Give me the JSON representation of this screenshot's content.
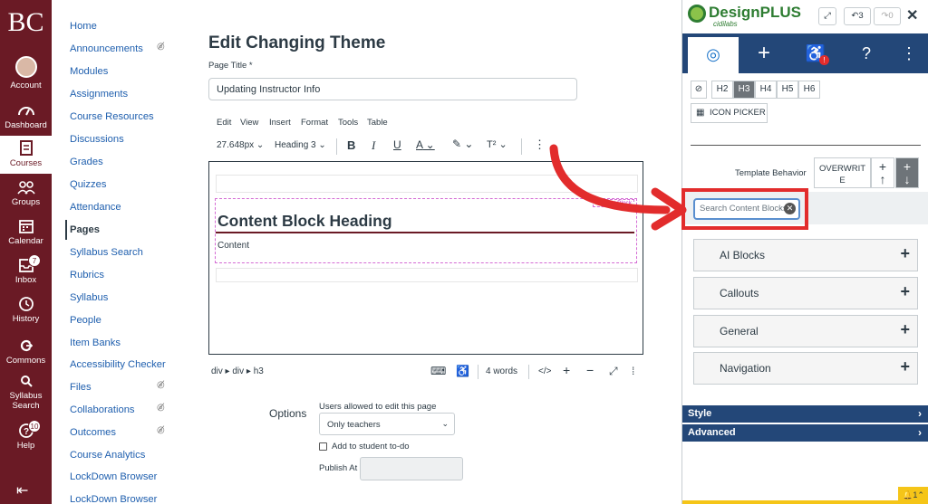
{
  "global_nav": {
    "logo": "BC",
    "items": [
      {
        "label": "Account",
        "icon": "avatar"
      },
      {
        "label": "Dashboard",
        "icon": "dashboard-icon"
      },
      {
        "label": "Courses",
        "icon": "courses-icon"
      },
      {
        "label": "Groups",
        "icon": "groups-icon"
      },
      {
        "label": "Calendar",
        "icon": "calendar-icon"
      },
      {
        "label": "Inbox",
        "icon": "inbox-icon",
        "badge": "7"
      },
      {
        "label": "History",
        "icon": "history-icon"
      },
      {
        "label": "Commons",
        "icon": "commons-icon"
      },
      {
        "label": "Syllabus",
        "label2": "Search",
        "icon": "search-icon"
      },
      {
        "label": "Help",
        "icon": "help-icon",
        "badge": "10"
      }
    ],
    "colors": {
      "background": "#6a1a25",
      "active": "#ffffff"
    }
  },
  "course_nav": {
    "links": [
      "Home",
      "Announcements",
      "Modules",
      "Assignments",
      "Course Resources",
      "Discussions",
      "Grades",
      "Quizzes",
      "Attendance",
      "Pages",
      "Syllabus Search",
      "Rubrics",
      "Syllabus",
      "People",
      "Item Banks",
      "Accessibility Checker",
      "Files",
      "Collaborations",
      "Outcomes",
      "Course Analytics",
      "LockDown Browser",
      "LockDown Browser"
    ],
    "active": "Pages"
  },
  "editor": {
    "page_heading": "Edit Changing Theme",
    "page_title_label": "Page Title",
    "required_mark": "*",
    "page_title_value": "Updating Instructor Info",
    "menu": [
      "Edit",
      "View",
      "Insert",
      "Format",
      "Tools",
      "Table"
    ],
    "toolbar": {
      "font_size": "27.648px",
      "block_format": "Heading 3",
      "bold": "B",
      "italic": "I",
      "underline": "U",
      "text_color": "A",
      "superscript": "T²",
      "more": "⋮"
    },
    "block_tag": "Content Block",
    "content_heading": "Content Block Heading",
    "content_text": "Content",
    "path": "div ▸ div ▸ h3",
    "word_count": "4 words",
    "code_view": "</>"
  },
  "options": {
    "label": "Options",
    "edit_label": "Users allowed to edit this page",
    "edit_value": "Only teachers",
    "todo_label": "Add to student to-do",
    "publish_at_label": "Publish At"
  },
  "designplus": {
    "brand": "DesignPLUS",
    "brand_sub": "cidilabs",
    "undo_count": "3",
    "redo_count": "0",
    "tabs": [
      "target-icon",
      "plus-icon",
      "accessibility-icon",
      "help-icon",
      "more-icon"
    ],
    "heading_buttons": [
      "H2",
      "H3",
      "H4",
      "H5",
      "H6"
    ],
    "selected_heading": "H3",
    "icon_picker": "ICON PICKER",
    "template_behavior_label": "Template Behavior",
    "overwrite_label": "OVERWRITE",
    "search_placeholder": "Search Content Blocks",
    "accordions": [
      "AI Blocks",
      "Callouts",
      "General",
      "Navigation"
    ],
    "bars": [
      "Style",
      "Advanced"
    ],
    "notification_count": "1",
    "colors": {
      "brand_green": "#2e7d32",
      "nav_blue": "#234778",
      "highlight_red": "#e22c2c"
    }
  }
}
